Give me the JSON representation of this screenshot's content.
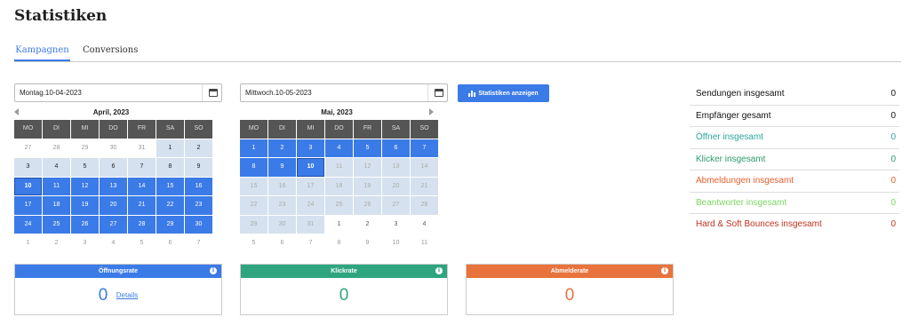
{
  "page": {
    "title": "Statistiken"
  },
  "tabs": [
    {
      "label": "Kampagnen",
      "active": true
    },
    {
      "label": "Conversions",
      "active": false
    }
  ],
  "date_from": {
    "value": "Montag.10-04-2023",
    "icon": "calendar-icon"
  },
  "date_to": {
    "value": "Mittwoch.10-05-2023",
    "icon": "calendar-icon"
  },
  "show_stats_button": {
    "label": "Statistiken anzeigen",
    "icon": "bar-chart-icon"
  },
  "weekdays": [
    "MO",
    "DI",
    "MI",
    "DO",
    "FR",
    "SA",
    "SO"
  ],
  "calendars": [
    {
      "month": "April, 2023",
      "days": [
        [
          "27",
          "other"
        ],
        [
          "28",
          "other"
        ],
        [
          "29",
          "other"
        ],
        [
          "30",
          "other"
        ],
        [
          "31",
          "other"
        ],
        [
          "1",
          "light"
        ],
        [
          "2",
          "light"
        ],
        [
          "3",
          "light"
        ],
        [
          "4",
          "light"
        ],
        [
          "5",
          "light"
        ],
        [
          "6",
          "light"
        ],
        [
          "7",
          "light"
        ],
        [
          "8",
          "light"
        ],
        [
          "9",
          "light"
        ],
        [
          "10",
          "cur"
        ],
        [
          "11",
          "sel"
        ],
        [
          "12",
          "sel"
        ],
        [
          "13",
          "sel"
        ],
        [
          "14",
          "sel"
        ],
        [
          "15",
          "sel"
        ],
        [
          "16",
          "sel"
        ],
        [
          "17",
          "sel"
        ],
        [
          "18",
          "sel"
        ],
        [
          "19",
          "sel"
        ],
        [
          "20",
          "sel"
        ],
        [
          "21",
          "sel"
        ],
        [
          "22",
          "sel"
        ],
        [
          "23",
          "sel"
        ],
        [
          "24",
          "sel"
        ],
        [
          "25",
          "sel"
        ],
        [
          "26",
          "sel"
        ],
        [
          "27",
          "sel"
        ],
        [
          "28",
          "sel"
        ],
        [
          "29",
          "sel"
        ],
        [
          "30",
          "sel"
        ],
        [
          "1",
          "other"
        ],
        [
          "2",
          "other"
        ],
        [
          "3",
          "other"
        ],
        [
          "4",
          "other"
        ],
        [
          "5",
          "other"
        ],
        [
          "6",
          "other"
        ],
        [
          "7",
          "other"
        ]
      ]
    },
    {
      "month": "Mai, 2023",
      "days": [
        [
          "1",
          "sel"
        ],
        [
          "2",
          "sel"
        ],
        [
          "3",
          "sel"
        ],
        [
          "4",
          "sel"
        ],
        [
          "5",
          "sel"
        ],
        [
          "6",
          "sel"
        ],
        [
          "7",
          "sel"
        ],
        [
          "8",
          "sel"
        ],
        [
          "9",
          "sel"
        ],
        [
          "10",
          "cur"
        ],
        [
          "11",
          "lightgray"
        ],
        [
          "12",
          "lightgray"
        ],
        [
          "13",
          "lightgray"
        ],
        [
          "14",
          "lightgray"
        ],
        [
          "15",
          "lightgray"
        ],
        [
          "16",
          "lightgray"
        ],
        [
          "17",
          "lightgray"
        ],
        [
          "18",
          "lightgray"
        ],
        [
          "19",
          "lightgray"
        ],
        [
          "20",
          "lightgray"
        ],
        [
          "21",
          "lightgray"
        ],
        [
          "22",
          "lightgray"
        ],
        [
          "23",
          "lightgray"
        ],
        [
          "24",
          "lightgray"
        ],
        [
          "25",
          "lightgray"
        ],
        [
          "26",
          "lightgray"
        ],
        [
          "27",
          "lightgray"
        ],
        [
          "28",
          "lightgray"
        ],
        [
          "29",
          "lightgray"
        ],
        [
          "30",
          "lightgray"
        ],
        [
          "31",
          "lightgray"
        ],
        [
          "1",
          "plain"
        ],
        [
          "2",
          "plain"
        ],
        [
          "3",
          "plain"
        ],
        [
          "4",
          "plain"
        ],
        [
          "5",
          "other"
        ],
        [
          "6",
          "other"
        ],
        [
          "7",
          "other"
        ],
        [
          "8",
          "other"
        ],
        [
          "9",
          "other"
        ],
        [
          "10",
          "other"
        ],
        [
          "11",
          "other"
        ]
      ]
    }
  ],
  "stats": [
    {
      "label": "Sendungen insgesamt",
      "value": "0",
      "color": "#111111"
    },
    {
      "label": "Empfänger gesamt",
      "value": "0",
      "color": "#111111"
    },
    {
      "label": "Öffner insgesamt",
      "value": "0",
      "color": "#2ba79b"
    },
    {
      "label": "Klicker insgesamt",
      "value": "0",
      "color": "#2a9a6e"
    },
    {
      "label": "Abmeldungen insgesamt",
      "value": "0",
      "color": "#e8602c"
    },
    {
      "label": "Beantworter insgesamt",
      "value": "0",
      "color": "#7ad85f"
    },
    {
      "label": "Hard & Soft Bounces insgesamt",
      "value": "0",
      "color": "#c0321f"
    }
  ],
  "cards": [
    {
      "title": "Öffnungsrate",
      "value": "0",
      "link": "Details",
      "head_color": "#3b7be8",
      "value_color": "#3b7be8"
    },
    {
      "title": "Klickrate",
      "value": "0",
      "head_color": "#2fa57f",
      "value_color": "#2fa57f"
    },
    {
      "title": "Abmelderate",
      "value": "0",
      "head_color": "#e8733c",
      "value_color": "#e8733c"
    }
  ]
}
